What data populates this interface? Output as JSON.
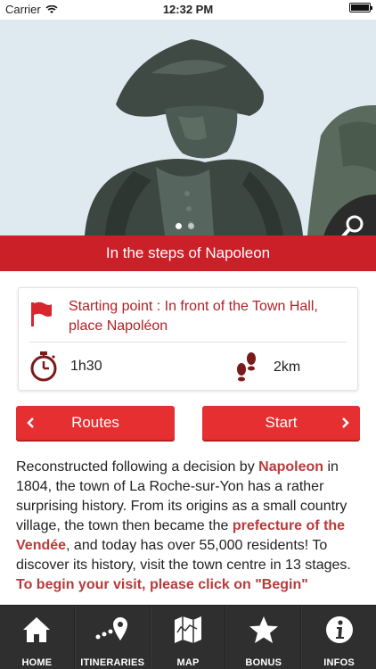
{
  "status_bar": {
    "carrier": "Carrier",
    "time": "12:32 PM"
  },
  "hero": {
    "slide_count": 2,
    "active_slide": 1,
    "search_icon": "search-icon"
  },
  "title": "In the steps of Napoleon",
  "info": {
    "start_label": "Starting point : In front of the Town Hall, place Napoléon",
    "duration": "1h30",
    "distance": "2km",
    "icons": [
      "flag-icon",
      "stopwatch-icon",
      "footsteps-icon"
    ]
  },
  "buttons": {
    "routes_label": "Routes",
    "start_label": "Start"
  },
  "description": {
    "t1": "Reconstructed following a decision by ",
    "l1": "Napoleon",
    "t2": " in 1804, the town of La Roche-sur-Yon has a rather surprising history. From its origins as a small country village, the town then became the ",
    "l2": "prefecture of the Vendée",
    "t3": ", and today has over 55,000 residents! To discover its history, visit the town centre in 13 stages. ",
    "l3": "To begin your visit, please click on \"Begin\""
  },
  "tabs": [
    {
      "label": "HOME",
      "icon": "home-icon"
    },
    {
      "label": "ITINERARIES",
      "icon": "route-pin-icon"
    },
    {
      "label": "MAP",
      "icon": "map-icon"
    },
    {
      "label": "BONUS",
      "icon": "star-icon"
    },
    {
      "label": "INFOS",
      "icon": "info-icon"
    }
  ],
  "colors": {
    "accent_red": "#cc2029",
    "button_red": "#e52f31",
    "link_red": "#b93a3a",
    "tab_bar": "#2f2f2f"
  }
}
